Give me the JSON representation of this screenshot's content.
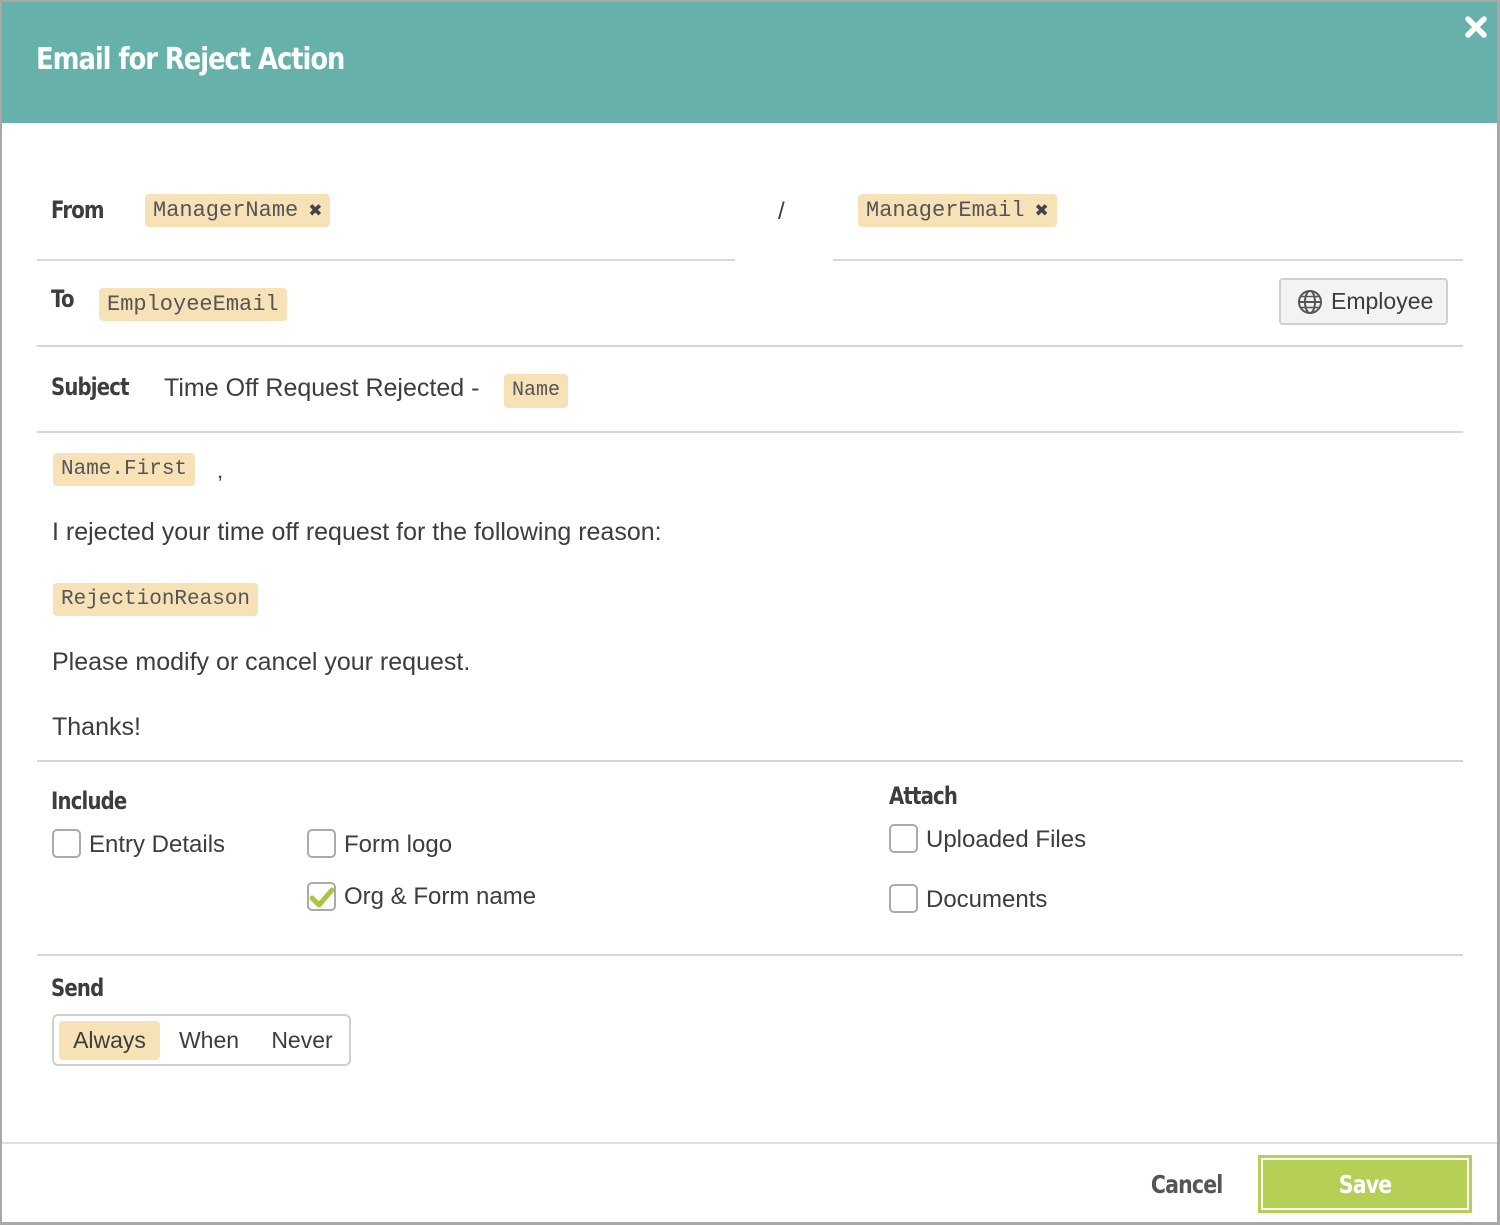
{
  "dialog": {
    "title": "Email for Reject Action",
    "close_icon": "close-icon"
  },
  "from": {
    "label": "From",
    "name_token": "ManagerName",
    "separator": "/",
    "email_token": "ManagerEmail"
  },
  "to": {
    "label": "To",
    "token": "EmployeeEmail",
    "recipient_button": {
      "icon": "globe-icon",
      "label": "Employee"
    }
  },
  "subject": {
    "label": "Subject",
    "text": "Time Off Request Rejected -",
    "token": "Name"
  },
  "body": {
    "greeting_token": "Name.First",
    "greeting_suffix": ",",
    "line1": "I rejected your time off request for the following reason:",
    "reason_token": "RejectionReason",
    "line2": "Please modify or cancel your request.",
    "line3": "Thanks!"
  },
  "include": {
    "label": "Include",
    "options": [
      {
        "label": "Entry Details",
        "checked": false
      },
      {
        "label": "Form logo",
        "checked": false
      },
      {
        "label": "Org & Form name",
        "checked": true
      }
    ]
  },
  "attach": {
    "label": "Attach",
    "options": [
      {
        "label": "Uploaded Files",
        "checked": false
      },
      {
        "label": "Documents",
        "checked": false
      }
    ]
  },
  "send": {
    "label": "Send",
    "options": [
      "Always",
      "When",
      "Never"
    ],
    "selected": "Always"
  },
  "footer": {
    "cancel_label": "Cancel",
    "save_label": "Save"
  },
  "colors": {
    "header": "#66b2aa",
    "token_bg": "#f7e2b8",
    "save": "#b6cf55",
    "check": "#a6c83c"
  }
}
